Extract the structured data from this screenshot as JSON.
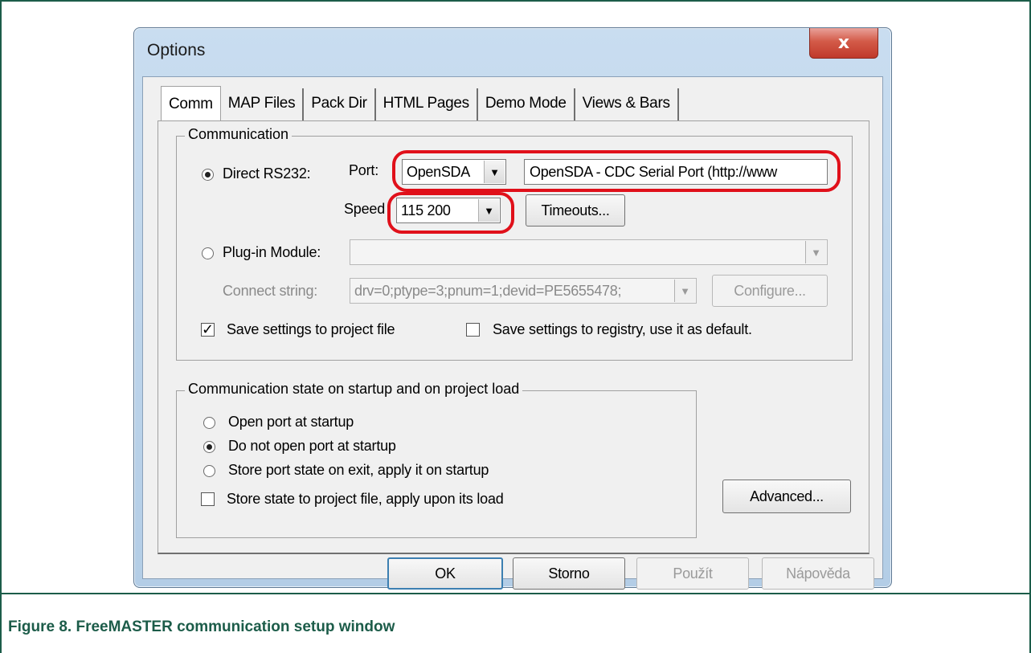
{
  "window": {
    "title": "Options",
    "close_glyph": "x"
  },
  "tabs": [
    {
      "label": "Comm",
      "active": true
    },
    {
      "label": "MAP Files"
    },
    {
      "label": "Pack Dir"
    },
    {
      "label": "HTML Pages"
    },
    {
      "label": "Demo Mode"
    },
    {
      "label": "Views & Bars"
    }
  ],
  "communication": {
    "group_label": "Communication",
    "direct_rs232_label": "Direct RS232:",
    "port_label": "Port:",
    "port_value": "OpenSDA",
    "port_description": "OpenSDA - CDC Serial Port (http://www",
    "speed_label": "Speed",
    "speed_value": "115 200",
    "timeouts_button": "Timeouts...",
    "plugin_label": "Plug-in Module:",
    "plugin_value": "",
    "connect_string_label": "Connect string:",
    "connect_string_value": "drv=0;ptype=3;pnum=1;devid=PE5655478;",
    "configure_button": "Configure...",
    "save_project_label": "Save settings to project file",
    "save_project_checked": true,
    "save_registry_label": "Save settings to registry, use it as default.",
    "save_registry_checked": false
  },
  "startup": {
    "group_label": "Communication state on startup and on project load",
    "options": [
      {
        "label": "Open port at startup",
        "checked": false
      },
      {
        "label": "Do not open port at startup",
        "checked": true
      },
      {
        "label": "Store port state on exit, apply it on startup",
        "checked": false
      }
    ],
    "store_state_label": "Store state to project file, apply upon its load",
    "store_state_checked": false,
    "advanced_button": "Advanced..."
  },
  "footer": {
    "ok": "OK",
    "cancel": "Storno",
    "apply": "Použít",
    "help": "Nápověda"
  },
  "caption": "Figure 8.  FreeMASTER communication setup window",
  "colors": {
    "caption": "#1c5c49",
    "highlight": "#e0101a"
  }
}
